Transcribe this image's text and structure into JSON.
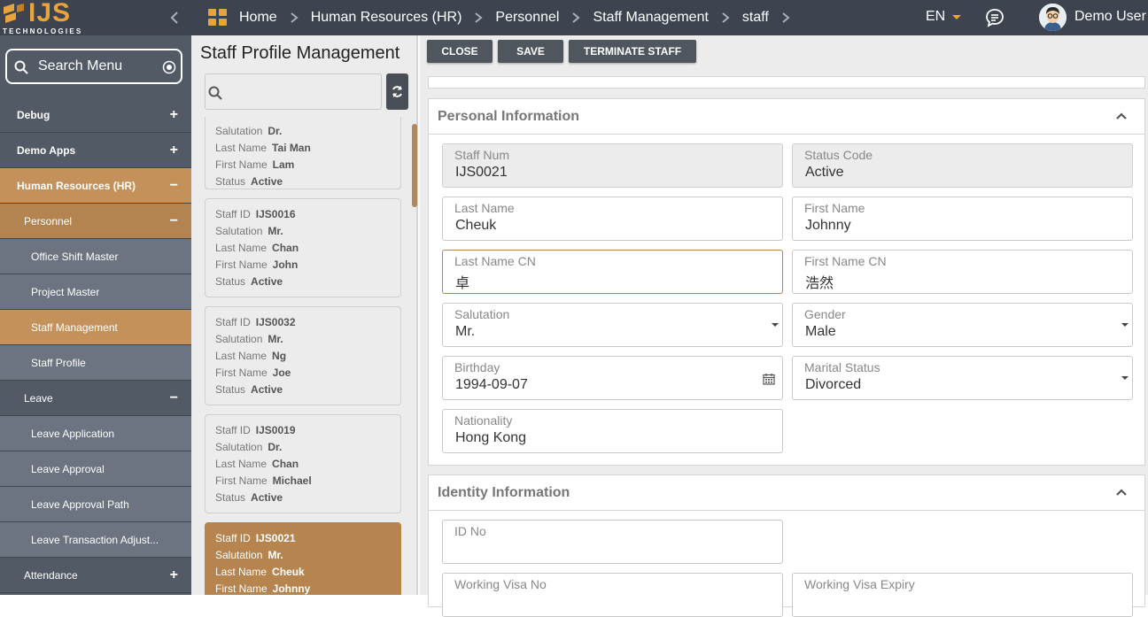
{
  "topbar": {
    "logo_text": "IJS",
    "logo_sub": "TECHNOLOGIES",
    "breadcrumbs": [
      "Home",
      "Human Resources (HR)",
      "Personnel",
      "Staff Management",
      "staff"
    ],
    "language": "EN",
    "username": "Demo User",
    "colors": {
      "bar": "#3d4450",
      "accent": "#e8a33a"
    }
  },
  "sidebar": {
    "search_label": "Search Menu",
    "items": [
      {
        "label": "Debug",
        "toggle": "+"
      },
      {
        "label": "Demo Apps",
        "toggle": "+"
      },
      {
        "label": "Human Resources (HR)",
        "toggle": "−"
      },
      {
        "label": "Personnel",
        "toggle": "−"
      },
      {
        "label": "Office Shift Master"
      },
      {
        "label": "Project Master"
      },
      {
        "label": "Staff Management"
      },
      {
        "label": "Staff Profile"
      },
      {
        "label": "Leave",
        "toggle": "−"
      },
      {
        "label": "Leave Application"
      },
      {
        "label": "Leave Approval"
      },
      {
        "label": "Leave Approval Path"
      },
      {
        "label": "Leave Transaction Adjust..."
      },
      {
        "label": "Attendance",
        "toggle": "+"
      }
    ]
  },
  "list": {
    "title": "Staff Profile Management",
    "search_value": "",
    "labels": {
      "staff_id": "Staff ID",
      "salutation": "Salutation",
      "last_name": "Last Name",
      "first_name": "First Name",
      "status": "Status"
    },
    "cards": [
      {
        "staff_id": "",
        "salutation": "Dr.",
        "last_name": "Tai Man",
        "first_name": "Lam",
        "status": "Active"
      },
      {
        "staff_id": "IJS0016",
        "salutation": "Mr.",
        "last_name": "Chan",
        "first_name": "John",
        "status": "Active"
      },
      {
        "staff_id": "IJS0032",
        "salutation": "Mr.",
        "last_name": "Ng",
        "first_name": "Joe",
        "status": "Active"
      },
      {
        "staff_id": "IJS0019",
        "salutation": "Dr.",
        "last_name": "Chan",
        "first_name": "Michael",
        "status": "Active"
      },
      {
        "staff_id": "IJS0021",
        "salutation": "Mr.",
        "last_name": "Cheuk",
        "first_name": "Johnny",
        "status": ""
      }
    ]
  },
  "toolbar": {
    "close": "CLOSE",
    "save": "SAVE",
    "terminate": "TERMINATE STAFF"
  },
  "personal": {
    "title": "Personal Information",
    "staff_num": {
      "label": "Staff Num",
      "value": "IJS0021"
    },
    "status_code": {
      "label": "Status Code",
      "value": "Active"
    },
    "last_name": {
      "label": "Last Name",
      "value": "Cheuk"
    },
    "first_name": {
      "label": "First Name",
      "value": "Johnny"
    },
    "last_name_cn": {
      "label": "Last Name CN",
      "value": "卓"
    },
    "first_name_cn": {
      "label": "First Name CN",
      "value": "浩然"
    },
    "salutation": {
      "label": "Salutation",
      "value": "Mr."
    },
    "gender": {
      "label": "Gender",
      "value": "Male"
    },
    "birthday": {
      "label": "Birthday",
      "value": "1994-09-07"
    },
    "marital_status": {
      "label": "Marital Status",
      "value": "Divorced"
    },
    "nationality": {
      "label": "Nationality",
      "value": "Hong Kong"
    }
  },
  "identity": {
    "title": "Identity Information",
    "id_no": {
      "label": "ID No",
      "value": ""
    },
    "working_visa_no": {
      "label": "Working Visa No",
      "value": ""
    },
    "working_visa_expiry": {
      "label": "Working Visa Expiry",
      "value": ""
    }
  }
}
